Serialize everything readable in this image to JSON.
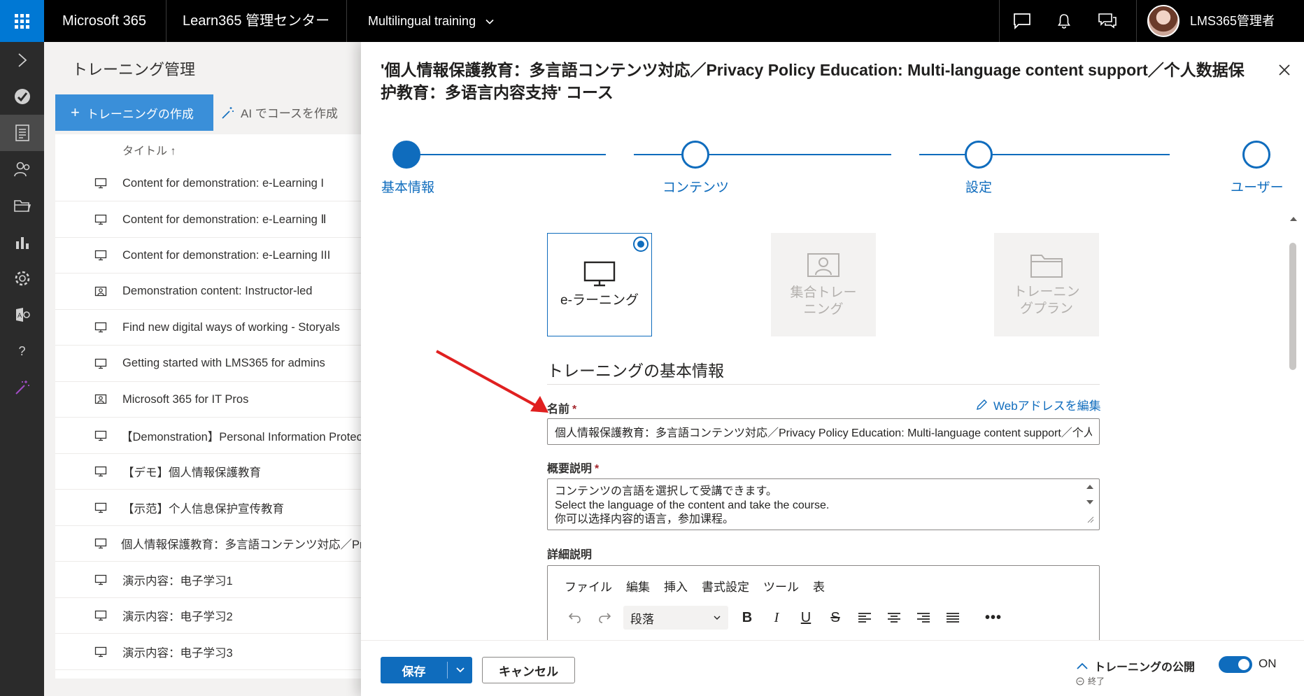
{
  "topbar": {
    "app_name": "Microsoft 365",
    "admin_center": "Learn365 管理センター",
    "tenant": "Multilingual training",
    "user_name": "LMS365管理者",
    "icons": [
      "waffle-icon",
      "chat-icon",
      "bell-icon",
      "feedback-icon"
    ]
  },
  "rail": {
    "items": [
      "expand-icon",
      "learn365-icon",
      "training-icon",
      "users-icon",
      "folder-icon",
      "reports-icon",
      "settings-icon",
      "app-icon",
      "help-icon",
      "magic-wand-icon"
    ]
  },
  "background": {
    "page_title": "トレーニング管理",
    "create_button": "トレーニングの作成",
    "ai_button": "AI でコースを作成",
    "column_title": "タイトル ↑",
    "rows": [
      {
        "icon": "monitor-icon",
        "title": "Content for demonstration: e-Learning I"
      },
      {
        "icon": "monitor-icon",
        "title": "Content for demonstration: e-Learning Ⅱ"
      },
      {
        "icon": "monitor-icon",
        "title": "Content for demonstration: e-Learning III"
      },
      {
        "icon": "classroom-icon",
        "title": "Demonstration content: Instructor-led"
      },
      {
        "icon": "monitor-icon",
        "title": "Find new digital ways of working - Storyals"
      },
      {
        "icon": "monitor-icon",
        "title": "Getting started with LMS365 for admins"
      },
      {
        "icon": "classroom-icon",
        "title": "Microsoft 365 for IT Pros"
      },
      {
        "icon": "monitor-icon",
        "title": "【Demonstration】Personal Information Protection"
      },
      {
        "icon": "monitor-icon",
        "title": "【デモ】個人情報保護教育"
      },
      {
        "icon": "monitor-icon",
        "title": "【示范】个人信息保护宣传教育"
      },
      {
        "icon": "monitor-icon",
        "title": "個人情報保護教育：多言語コンテンツ対応／Privacy"
      },
      {
        "icon": "monitor-icon",
        "title": "演示内容：电子学习1"
      },
      {
        "icon": "monitor-icon",
        "title": "演示内容：电子学习2"
      },
      {
        "icon": "monitor-icon",
        "title": "演示内容：电子学习3"
      }
    ]
  },
  "panel": {
    "title": "'個人情報保護教育：多言語コンテンツ対応／Privacy Policy Education: Multi-language content support／个人数据保护教育：多语言内容支持' コース",
    "steps": [
      "基本情報",
      "コンテンツ",
      "設定",
      "ユーザー"
    ],
    "types": {
      "elearning": "e-ラーニング",
      "classroom": "集合トレーニング",
      "plan": "トレーニングプラン"
    },
    "section_title": "トレーニングの基本情報",
    "name_label": "名前",
    "required_mark": "*",
    "web_address_link": "Webアドレスを編集",
    "name_value": "個人情報保護教育：多言語コンテンツ対応／Privacy Policy Education: Multi-language content support／个人数据保护教育：多语言内容支持",
    "summary_label": "概要説明",
    "summary_lines": [
      "コンテンツの言語を選択して受講できます。",
      "Select the language of the content and take the course.",
      "你可以选择内容的语言，参加课程。"
    ],
    "detail_label": "詳細説明",
    "editor_menu": [
      "ファイル",
      "編集",
      "挿入",
      "書式設定",
      "ツール",
      "表"
    ],
    "paragraph_select": "段落"
  },
  "footer": {
    "save": "保存",
    "cancel": "キャンセル",
    "publish_label": "トレーニングの公開",
    "publish_sub": "終了",
    "toggle_state": "ON"
  },
  "colors": {
    "accent": "#0f6cbd",
    "arrow": "#e02020"
  }
}
